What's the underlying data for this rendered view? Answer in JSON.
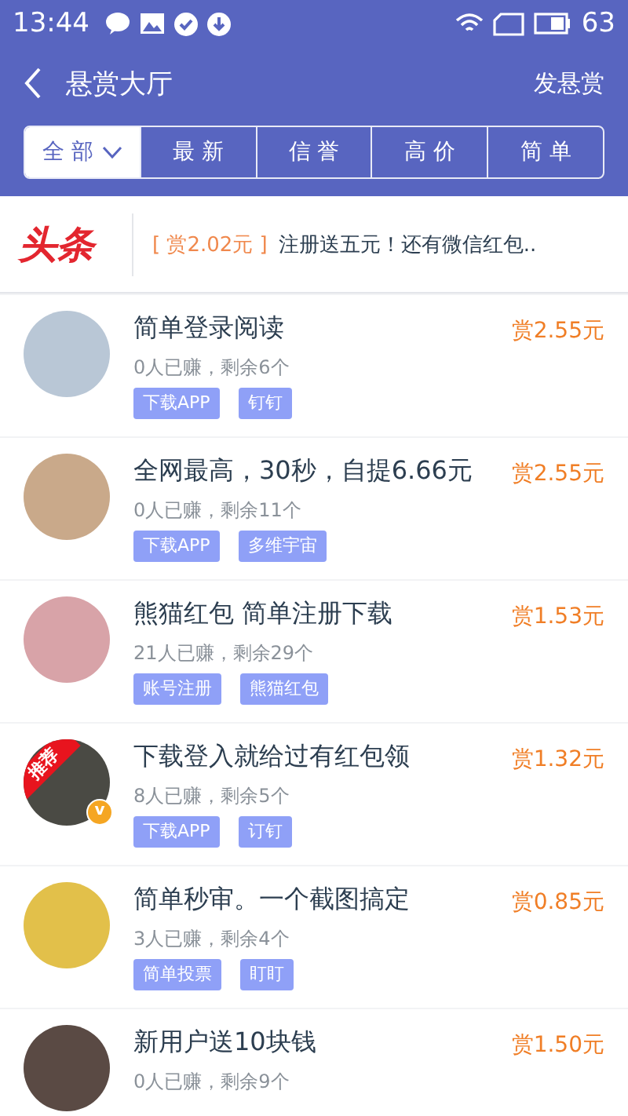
{
  "status_bar": {
    "time": "13:44",
    "battery": "63"
  },
  "nav": {
    "title": "悬赏大厅",
    "action": "发悬赏"
  },
  "tabs": [
    {
      "label": "全 部",
      "selected": true,
      "dropdown": true
    },
    {
      "label": "最 新",
      "selected": false,
      "dropdown": false
    },
    {
      "label": "信 誉",
      "selected": false,
      "dropdown": false
    },
    {
      "label": "高 价",
      "selected": false,
      "dropdown": false
    },
    {
      "label": "简 单",
      "selected": false,
      "dropdown": false
    }
  ],
  "banner": {
    "logo": "头条",
    "reward": "[ 赏2.02元 ]",
    "text": "注册送五元！还有微信红包.."
  },
  "tasks": [
    {
      "title": "简单登录阅读",
      "stats": "0人已赚，剩余6个",
      "reward": "赏2.55元",
      "tags": [
        "下载APP",
        "钉钉"
      ],
      "verified": false
    },
    {
      "title": "全网最高，30秒，自提6.66元",
      "stats": "0人已赚，剩余11个",
      "reward": "赏2.55元",
      "tags": [
        "下载APP",
        "多维宇宙"
      ],
      "verified": false
    },
    {
      "title": "熊猫红包  简单注册下载",
      "stats": "21人已赚，剩余29个",
      "reward": "赏1.53元",
      "tags": [
        "账号注册",
        "熊猫红包"
      ],
      "verified": false
    },
    {
      "title": "下载登入就给过有红包领",
      "stats": "8人已赚，剩余5个",
      "reward": "赏1.32元",
      "tags": [
        "下载APP",
        "订钉"
      ],
      "verified": true,
      "ribbon": "推荐",
      "verified_mark": "v"
    },
    {
      "title": "简单秒审。一个截图搞定",
      "stats": "3人已赚，剩余4个",
      "reward": "赏0.85元",
      "tags": [
        "简单投票",
        "盯盯"
      ],
      "verified": false
    },
    {
      "title": "新用户送10块钱",
      "stats": "0人已赚，剩余9个",
      "reward": "赏1.50元",
      "verified": false
    }
  ]
}
